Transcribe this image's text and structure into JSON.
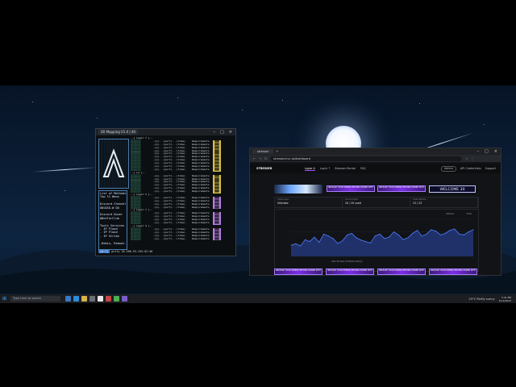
{
  "terminal": {
    "tab_title": "SR Mapping V1.0 | 40",
    "menu_lines": [
      "List of Methods",
      "Top 1% News",
      "",
      "Discord Channel",
      "DDGOSO.W DO",
      "",
      "Discord Owner",
      "@BetTorClub",
      "",
      "Tools Services",
      "- IP Flood",
      "- IP Flood",
      "- IP Strike",
      "",
      "-Rebin, Reboot-"
    ],
    "sections": [
      {
        "label": "Layer 7",
        "rows": 10
      },
      {
        "label": "L4",
        "rows": 6
      },
      {
        "label": "Layer 3",
        "rows": 4
      },
      {
        "label": "Layer 7",
        "rows": 4
      },
      {
        "label": "Layer 4",
        "rows": 4
      }
    ],
    "row_mid": "-(p)- -(port)- -(time)-",
    "row_req": "Requirements",
    "status_left": "[0:1]",
    "status_right": "putty 10.206.93.192:52:46"
  },
  "browser": {
    "tab_title": "stresser",
    "url": "stresser.hvc.io/dashboard",
    "brand": "STRESSER",
    "nav": [
      "Layer 4",
      "Layer 7",
      "Browser Rental",
      "FAQ"
    ],
    "nav_active": 0,
    "right_items": [
      "Admin",
      "API Credentials",
      "Support"
    ],
    "welcome": "WELCOME 30",
    "stats": [
      {
        "label": "Active plan",
        "value": "Ultimate"
      },
      {
        "label": "Concurrents",
        "value": "20 / 20 used"
      },
      {
        "label": "Total attacks",
        "value": "23 / 23"
      }
    ],
    "banner_text": "UNLEASH YOUR STRESS TESTING POWER WITH",
    "legend_attacks": "Attacks",
    "legend_time": "Time",
    "chart_note": "Last 30 days of attack history"
  },
  "chart_data": {
    "type": "area",
    "title": "",
    "series": [
      {
        "values": [
          30,
          34,
          28,
          45,
          40,
          52,
          38,
          60,
          55,
          48,
          35,
          42,
          58,
          62,
          50,
          44,
          40,
          36,
          55,
          60,
          48,
          52,
          66,
          58,
          45,
          50,
          62,
          70,
          55,
          60,
          72,
          68,
          58,
          62,
          70,
          74,
          60,
          58,
          66,
          72
        ]
      }
    ],
    "ylim": [
      0,
      100
    ],
    "colors": {
      "line": "#4f7dff",
      "fill": "#243a80"
    }
  },
  "taskbar": {
    "search_placeholder": "Type here to search",
    "weather": "23°C  Partly sunny",
    "time": "3:41 PM",
    "date": "10/1/2023"
  }
}
